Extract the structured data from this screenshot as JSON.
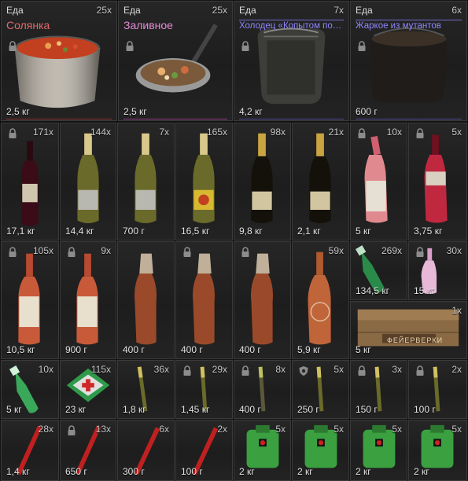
{
  "palette": {
    "rarity_red": "#e06060",
    "rarity_pink": "#e58ad6",
    "rarity_blue": "#8f86ff",
    "lock_gray": "#8c8c8c"
  },
  "top_row": [
    {
      "category": "Еда",
      "count": "25x",
      "name": "Солянка",
      "name_color": "#e06a6a",
      "weight": "2,5 кг",
      "icon": "pot-icon"
    },
    {
      "category": "Еда",
      "count": "25x",
      "name": "Заливное",
      "name_color": "#e58ad6",
      "weight": "2,5 кг",
      "icon": "pan-icon"
    },
    {
      "category": "Еда",
      "count": "7x",
      "name": "Холодец «Копытом по л...",
      "name_color": "#8f86ff",
      "weight": "4,2 кг",
      "icon": "mess-tin-icon"
    },
    {
      "category": "Еда",
      "count": "6x",
      "name": "Жаркое из мутантов",
      "name_color": "#8f86ff",
      "weight": "600 г",
      "icon": "dark-pot-icon"
    }
  ],
  "row2": [
    {
      "count": "171x",
      "weight": "17,1 кг",
      "icon": "red-wine-bottle-icon"
    },
    {
      "count": "144x",
      "weight": "14,4 кг",
      "icon": "champagne-bottle-icon"
    },
    {
      "count": "7x",
      "weight": "700 г",
      "icon": "champagne-bottle-icon"
    },
    {
      "count": "165x",
      "weight": "16,5 кг",
      "icon": "champagne-bottle-icon"
    },
    {
      "count": "98x",
      "weight": "9,8 кг",
      "icon": "gold-champagne-icon"
    },
    {
      "count": "21x",
      "weight": "2,1 кг",
      "icon": "gold-champagne-icon"
    },
    {
      "count": "10x",
      "weight": "5 кг",
      "icon": "pink-bottle-icon"
    },
    {
      "count": "5x",
      "weight": "3,75 кг",
      "icon": "red-bottle-icon"
    }
  ],
  "row3": [
    {
      "count": "105x",
      "weight": "10,5 кг",
      "icon": "vodka-bottle-icon"
    },
    {
      "count": "9x",
      "weight": "900 г",
      "icon": "vodka-bottle-icon"
    },
    {
      "count": "",
      "weight": "400 г",
      "icon": "molotov-bottle-icon"
    },
    {
      "count": "",
      "weight": "400 г",
      "icon": "molotov-bottle-icon"
    },
    {
      "count": "",
      "weight": "400 г",
      "icon": "molotov-bottle-icon"
    },
    {
      "count": "59x",
      "weight": "5,9 кг",
      "icon": "brown-bottle-icon"
    },
    {
      "count": "269x",
      "weight": "134,5 кг",
      "icon": "green-bottle-icon"
    },
    {
      "count": "30x",
      "weight": "15 кг",
      "icon": "pink-flask-icon"
    }
  ],
  "fireworks": {
    "count": "1x",
    "weight": "5 кг",
    "crate_label": "ФЕЙЕРВЕРКИ",
    "icon": "fireworks-crate-icon"
  },
  "row4": [
    {
      "count": "10x",
      "weight": "5 кг",
      "icon": "green-bottle-icon"
    },
    {
      "count": "115x",
      "weight": "23 кг",
      "icon": "first-aid-kit-icon"
    },
    {
      "count": "36x",
      "weight": "1,8 кг",
      "icon": "firework-rocket-icon"
    },
    {
      "count": "29x",
      "weight": "1,45 кг",
      "icon": "firework-rocket-icon"
    },
    {
      "count": "8x",
      "weight": "400 г",
      "icon": "firework-rocket-icon"
    },
    {
      "count": "5x",
      "weight": "250 г",
      "icon": "firework-rocket-icon"
    },
    {
      "count": "3x",
      "weight": "150 г",
      "icon": "firework-rocket-icon"
    },
    {
      "count": "2x",
      "weight": "100 г",
      "icon": "firework-rocket-icon"
    }
  ],
  "row5": [
    {
      "count": "28x",
      "weight": "1,4 кг",
      "icon": "red-flare-icon"
    },
    {
      "count": "13x",
      "weight": "650 г",
      "icon": "red-flare-icon"
    },
    {
      "count": "6x",
      "weight": "300 г",
      "icon": "red-flare-icon"
    },
    {
      "count": "2x",
      "weight": "100 г",
      "icon": "red-flare-icon"
    },
    {
      "count": "5x",
      "weight": "2 кг",
      "icon": "medkit-pouch-icon"
    },
    {
      "count": "5x",
      "weight": "2 кг",
      "icon": "medkit-pouch-icon"
    },
    {
      "count": "5x",
      "weight": "2 кг",
      "icon": "medkit-pouch-icon"
    },
    {
      "count": "5x",
      "weight": "2 кг",
      "icon": "medkit-pouch-icon"
    }
  ]
}
